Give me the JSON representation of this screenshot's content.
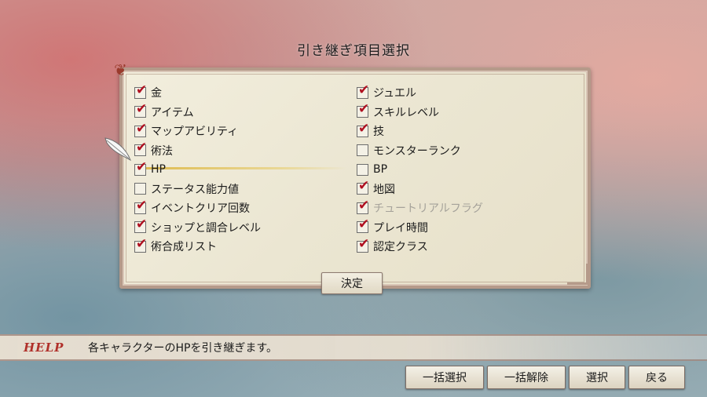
{
  "screen": {
    "title": "引き継ぎ項目選択",
    "confirm_label": "決定"
  },
  "left_items": [
    {
      "label": "金",
      "checked": true,
      "disabled": false
    },
    {
      "label": "アイテム",
      "checked": true,
      "disabled": false
    },
    {
      "label": "マップアビリティ",
      "checked": true,
      "disabled": false
    },
    {
      "label": "術法",
      "checked": true,
      "disabled": false
    },
    {
      "label": "HP",
      "checked": true,
      "disabled": false
    },
    {
      "label": "ステータス能力値",
      "checked": false,
      "disabled": false
    },
    {
      "label": "イベントクリア回数",
      "checked": true,
      "disabled": false
    },
    {
      "label": "ショップと調合レベル",
      "checked": true,
      "disabled": false
    },
    {
      "label": "術合成リスト",
      "checked": true,
      "disabled": false
    }
  ],
  "right_items": [
    {
      "label": "ジュエル",
      "checked": true,
      "disabled": false
    },
    {
      "label": "スキルレベル",
      "checked": true,
      "disabled": false
    },
    {
      "label": "技",
      "checked": true,
      "disabled": false
    },
    {
      "label": "モンスターランク",
      "checked": false,
      "disabled": false
    },
    {
      "label": "BP",
      "checked": false,
      "disabled": false
    },
    {
      "label": "地図",
      "checked": true,
      "disabled": false
    },
    {
      "label": "チュートリアルフラグ",
      "checked": true,
      "disabled": true
    },
    {
      "label": "プレイ時間",
      "checked": true,
      "disabled": false
    },
    {
      "label": "認定クラス",
      "checked": true,
      "disabled": false
    }
  ],
  "help": {
    "tag": "HELP",
    "text": "各キャラクターのHPを引き継ぎます。"
  },
  "buttons": {
    "select_all": "一括選択",
    "deselect_all": "一括解除",
    "select": "選択",
    "back": "戻る"
  },
  "colors": {
    "check": "#b01020",
    "help_tag": "#b0302a"
  }
}
